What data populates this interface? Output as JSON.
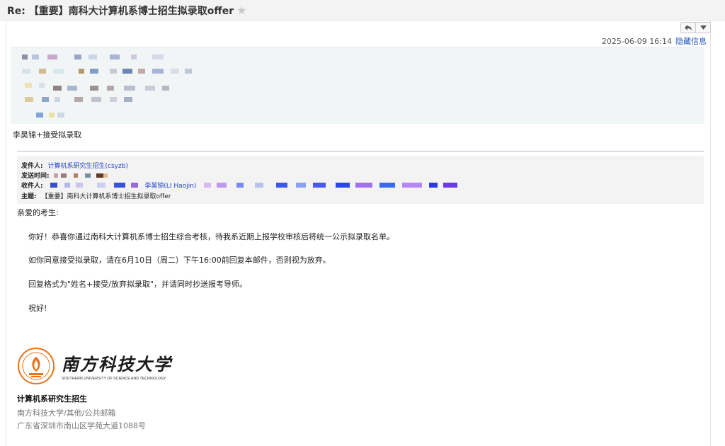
{
  "email": {
    "subject": "Re: 【重要】南科大计算机系博士招生拟录取offer",
    "date": "2025-06-09 16:14",
    "hide_info": "隐藏信息",
    "reply_text": "李昊锦+接受拟录取"
  },
  "original": {
    "from_label": "发件人:",
    "from_value": "计算机系研究生招生(csyzb)",
    "sent_label": "发送时间:",
    "to_label": "收件人:",
    "to_value": "李昊锦(LI Haojin)",
    "subject_label": "主题:",
    "subject_value": "【重要】南科大计算机系博士招生拟录取offer"
  },
  "body": {
    "greeting": "亲爱的考生:",
    "p1": "你好！恭喜你通过南科大计算机系博士招生综合考核，待我系近期上报学校审核后将统一公示拟录取名单。",
    "p2": "如你同意接受拟录取，请在6月10日（周二）下午16:00前回复本邮件，否则视为放弃。",
    "p3": "回复格式为\"姓名+接受/放弃拟录取\"，并请同时抄送报考导师。",
    "closing": "祝好!"
  },
  "logo": {
    "cn_name": "南方科技大学",
    "en_name": "SOUTHERN UNIVERSITY OF SCIENCE AND TECHNOLOGY",
    "color": "#e8731a"
  },
  "signature": {
    "name": "计算机系研究生招生",
    "org": "南方科技大学/其他/公共邮箱",
    "address": "广东省深圳市南山区学苑大道1088号"
  },
  "icons": {
    "reply": "reply-icon",
    "dropdown": "chevron-down-icon",
    "star": "star-icon"
  }
}
